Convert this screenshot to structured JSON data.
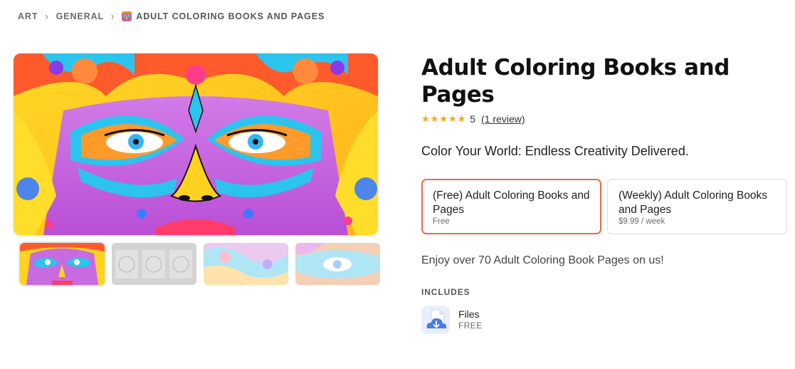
{
  "breadcrumb": {
    "items": [
      "ART",
      "GENERAL"
    ],
    "current": "ADULT COLORING BOOKS AND PAGES"
  },
  "product": {
    "title": "Adult Coloring Books and Pages",
    "rating_value": "5",
    "stars": 5,
    "review_text": "(1 review)",
    "tagline": "Color Your World: Endless Creativity Delivered.",
    "description": "Enjoy over 70 Adult Coloring Book Pages on us!"
  },
  "plans": [
    {
      "name": "(Free) Adult Coloring Books and Pages",
      "price": "Free",
      "selected": true
    },
    {
      "name": "(Weekly) Adult Coloring Books and Pages",
      "price": "$9.99 / week",
      "selected": false
    }
  ],
  "includes": {
    "label": "INCLUDES",
    "items": [
      {
        "name": "Files",
        "price": "FREE",
        "icon": "cloud-download-icon"
      }
    ]
  },
  "gallery": {
    "thumbnail_count": 4,
    "active_index": 0
  },
  "colors": {
    "accent": "#f0674b",
    "star": "#f5a623",
    "icon_blue": "#4a7be8"
  }
}
